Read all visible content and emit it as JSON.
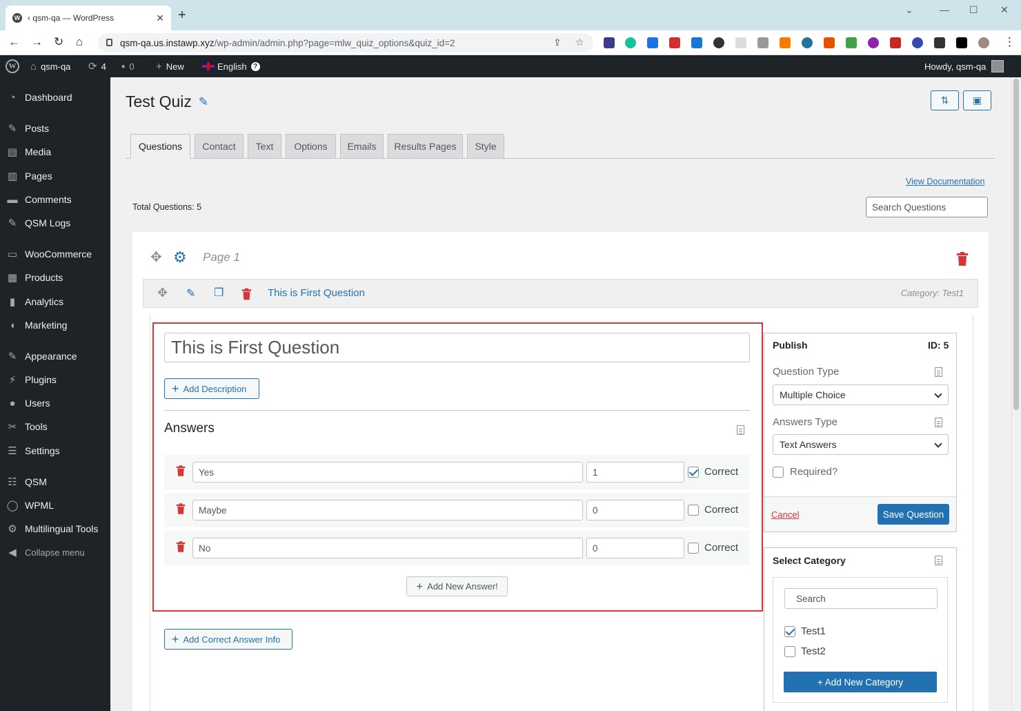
{
  "browser": {
    "tab_title": "‹ qsm-qa — WordPress",
    "url_domain": "qsm-qa.us.instawp.xyz",
    "url_path": "/wp-admin/admin.php?page=mlw_quiz_options&quiz_id=2"
  },
  "adminbar": {
    "site_name": "qsm-qa",
    "updates_count": "4",
    "comments_count": "0",
    "new_label": "New",
    "language": "English",
    "howdy": "Howdy, qsm-qa"
  },
  "sidebar": {
    "items": [
      {
        "label": "Dashboard",
        "icon": "dashboard-icon"
      },
      {
        "label": "Posts",
        "icon": "pin-icon"
      },
      {
        "label": "Media",
        "icon": "media-icon"
      },
      {
        "label": "Pages",
        "icon": "pages-icon"
      },
      {
        "label": "Comments",
        "icon": "comment-icon"
      },
      {
        "label": "QSM Logs",
        "icon": "pin-icon"
      },
      {
        "label": "WooCommerce",
        "icon": "woo-icon"
      },
      {
        "label": "Products",
        "icon": "archive-icon"
      },
      {
        "label": "Analytics",
        "icon": "chart-icon"
      },
      {
        "label": "Marketing",
        "icon": "megaphone-icon"
      },
      {
        "label": "Appearance",
        "icon": "brush-icon"
      },
      {
        "label": "Plugins",
        "icon": "plugin-icon"
      },
      {
        "label": "Users",
        "icon": "user-icon"
      },
      {
        "label": "Tools",
        "icon": "wrench-icon"
      },
      {
        "label": "Settings",
        "icon": "sliders-icon"
      },
      {
        "label": "QSM",
        "icon": "list-icon"
      },
      {
        "label": "WPML",
        "icon": "wpml-icon"
      },
      {
        "label": "Multilingual Tools",
        "icon": "translate-icon"
      }
    ],
    "collapse_label": "Collapse menu"
  },
  "page": {
    "title": "Test Quiz",
    "tabs": [
      "Questions",
      "Contact",
      "Text",
      "Options",
      "Emails",
      "Results Pages",
      "Style"
    ],
    "active_tab": "Questions",
    "view_documentation": "View Documentation",
    "total_questions": "Total Questions: 5",
    "search_placeholder": "Search Questions"
  },
  "quiz_page": {
    "label": "Page 1",
    "question": {
      "title": "This is First Question",
      "category": "Category: Test1"
    }
  },
  "editor": {
    "question_text": "This is First Question",
    "add_description": "Add Description",
    "answers_heading": "Answers",
    "answers": [
      {
        "text": "Yes",
        "points": "1",
        "correct": true
      },
      {
        "text": "Maybe",
        "points": "0",
        "correct": false
      },
      {
        "text": "No",
        "points": "0",
        "correct": false
      }
    ],
    "correct_label": "Correct",
    "add_new_answer": "Add New Answer!",
    "add_correct_answer_info": "Add Correct Answer Info"
  },
  "publish": {
    "heading": "Publish",
    "id_label": "ID: 5",
    "question_type_label": "Question Type",
    "question_type_value": "Multiple Choice",
    "answers_type_label": "Answers Type",
    "answers_type_value": "Text Answers",
    "required_label": "Required?",
    "cancel": "Cancel",
    "save": "Save Question"
  },
  "category": {
    "heading": "Select Category",
    "search_placeholder": "Search",
    "items": [
      {
        "label": "Test1",
        "checked": true
      },
      {
        "label": "Test2",
        "checked": false
      }
    ],
    "add_new": "+ Add New Category"
  },
  "colors": {
    "accent": "#2271b1",
    "danger": "#d63638",
    "adminbar": "#1d2327"
  }
}
